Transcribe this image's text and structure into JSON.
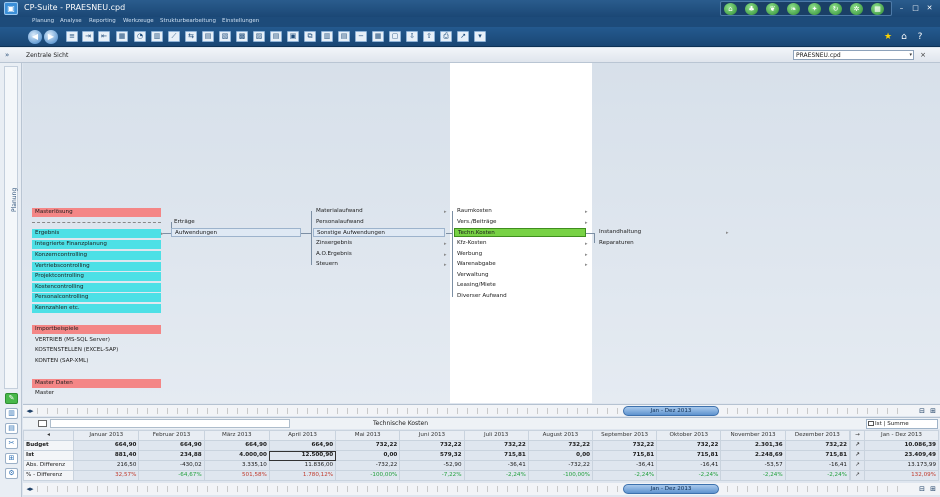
{
  "window": {
    "title": "CP-Suite - PRAESNEU.cpd"
  },
  "menu": [
    "Planung",
    "Analyse",
    "Reporting",
    "Werkzeuge",
    "Strukturbearbeitung",
    "Einstellungen"
  ],
  "subheader": {
    "view_title": "Zentrale Sicht",
    "file": "PRAESNEU.cpd"
  },
  "sidebar": {
    "tab_label": "Planung"
  },
  "col1": {
    "group1": [
      "Masterlösung"
    ],
    "group1_items": [
      "Ergebnis",
      "Integrierte Finanzplanung",
      "Konzerncontrolling",
      "Vertriebscontrolling",
      "Projektcontrolling",
      "Kostencontrolling",
      "Personalcontrolling",
      "Kennzahlen etc."
    ],
    "group2": "Importbeispiele",
    "group2_items": [
      "VERTRIEB (MS-SQL Server)",
      "KOSTENSTELLEN (EXCEL-SAP)",
      "KONTEN (SAP-XML)"
    ],
    "group3": "Master Daten",
    "group3_items": [
      "Master"
    ]
  },
  "col2": [
    "Erträge",
    "Aufwendungen"
  ],
  "col3": [
    "Materialaufwand",
    "Personalaufwand",
    "Sonstige Aufwendungen",
    "Zinsergebnis",
    "A.O.Ergebnis",
    "Steuern"
  ],
  "col4": [
    "Raumkosten",
    "Vers./Beiträge",
    "Techn.Kosten",
    "Kfz-Kosten",
    "Werbung",
    "Warenabgabe",
    "Verwaltung",
    "Leasing/Miete",
    "Diverser Aufwand"
  ],
  "col5": [
    "Instandhaltung",
    "Reparaturen"
  ],
  "timeline": {
    "range_label": "Jan - Dez 2013"
  },
  "grid": {
    "caption": "Technische Kosten",
    "sum_label": "Ist | Summe",
    "months": [
      "Januar 2013",
      "Februar 2013",
      "März 2013",
      "April 2013",
      "Mai 2013",
      "Juni 2013",
      "Juli 2013",
      "August 2013",
      "September 2013",
      "Oktober 2013",
      "November 2013",
      "Dezember 2013"
    ],
    "sum_header": "Jan - Dez 2013",
    "rows": [
      {
        "label": "Budget",
        "values": [
          "664,90",
          "664,90",
          "664,90",
          "664,90",
          "732,22",
          "732,22",
          "732,22",
          "732,22",
          "732,22",
          "732,22",
          "2.301,36",
          "732,22"
        ],
        "sum": "10.086,39"
      },
      {
        "label": "Ist",
        "values": [
          "881,40",
          "234,88",
          "4.000,00",
          "12.500,90",
          "0,00",
          "579,32",
          "715,81",
          "0,00",
          "715,81",
          "715,81",
          "2.248,69",
          "715,81"
        ],
        "sum": "23.409,49"
      },
      {
        "label": "Abs. Differenz",
        "values": [
          "216,50",
          "-430,02",
          "3.335,10",
          "11.836,00",
          "-732,22",
          "-52,90",
          "-36,41",
          "-732,22",
          "-36,41",
          "-16,41",
          "-53,57",
          "-16,41"
        ],
        "sum": "13.173,99"
      },
      {
        "label": "% - Differenz",
        "values": [
          "32,57%",
          "-64,67%",
          "501,58%",
          "1.780,12%",
          "-100,00%",
          "-7,22%",
          "-2,24%",
          "-100,00%",
          "-2,24%",
          "-2,24%",
          "-2,24%",
          "-2,24%"
        ],
        "sum": "132,09%"
      }
    ]
  }
}
